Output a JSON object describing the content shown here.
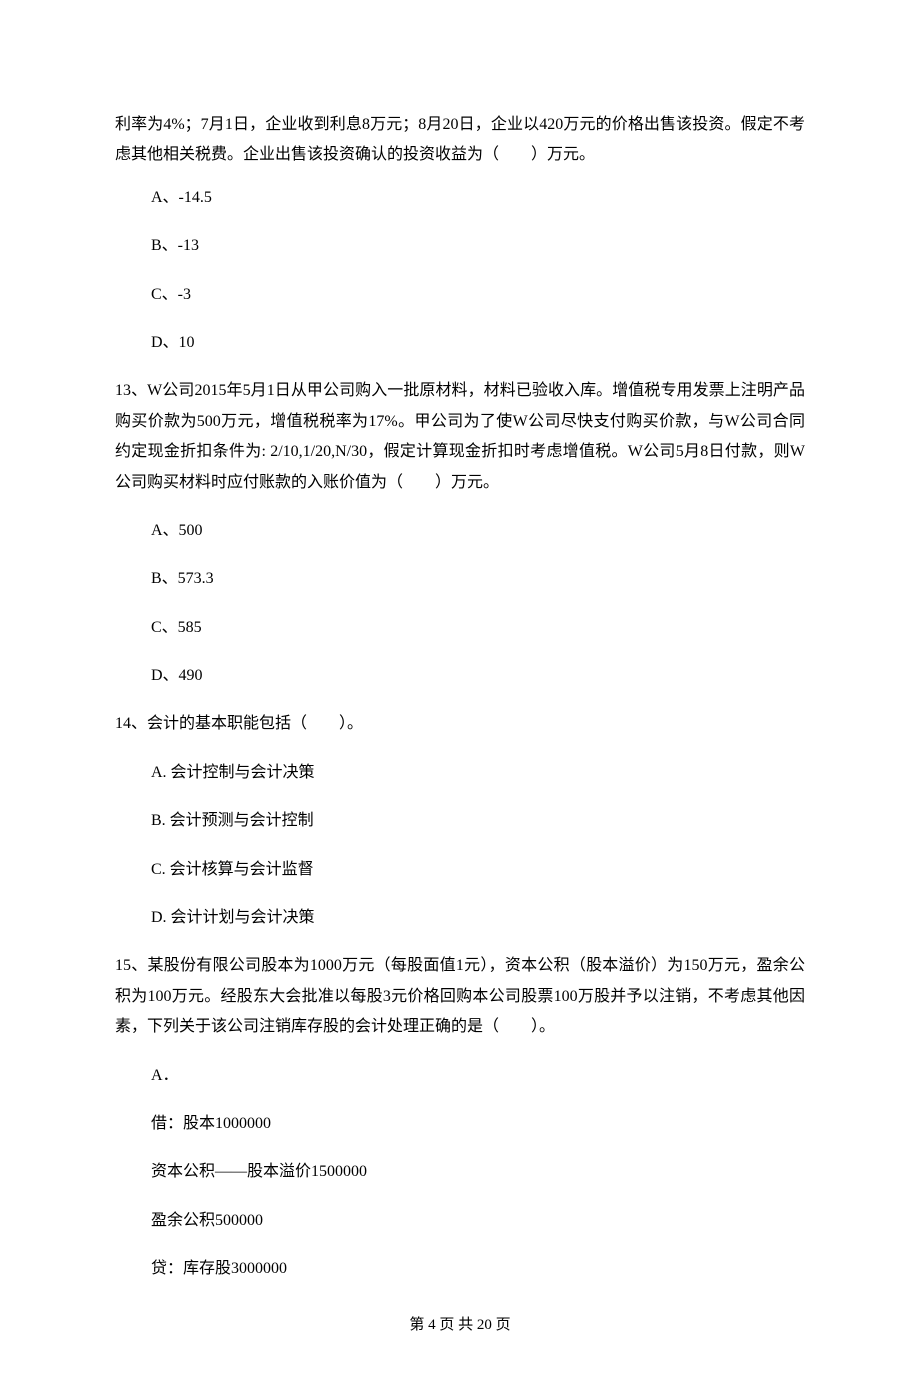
{
  "intro": "利率为4%；7月1日，企业收到利息8万元；8月20日，企业以420万元的价格出售该投资。假定不考虑其他相关税费。企业出售该投资确认的投资收益为（　　）万元。",
  "q12_options": {
    "a": "A、-14.5",
    "b": "B、-13",
    "c": "C、-3",
    "d": "D、10"
  },
  "q13": "13、W公司2015年5月1日从甲公司购入一批原材料，材料已验收入库。增值税专用发票上注明产品购买价款为500万元，增值税税率为17%。甲公司为了使W公司尽快支付购买价款，与W公司合同约定现金折扣条件为: 2/10,1/20,N/30，假定计算现金折扣时考虑增值税。W公司5月8日付款，则W公司购买材料时应付账款的入账价值为（　　）万元。",
  "q13_options": {
    "a": "A、500",
    "b": "B、573.3",
    "c": "C、585",
    "d": "D、490"
  },
  "q14": "14、会计的基本职能包括（　　）。",
  "q14_options": {
    "a": "A. 会计控制与会计决策",
    "b": "B. 会计预测与会计控制",
    "c": "C. 会计核算与会计监督",
    "d": "D. 会计计划与会计决策"
  },
  "q15": "15、某股份有限公司股本为1000万元（每股面值1元），资本公积（股本溢价）为150万元，盈余公积为100万元。经股东大会批准以每股3元价格回购本公司股票100万股并予以注销，不考虑其他因素，下列关于该公司注销库存股的会计处理正确的是（　　）。",
  "q15a": {
    "label": "A．",
    "line1": "借：股本1000000",
    "line2": "资本公积——股本溢价1500000",
    "line3": "盈余公积500000",
    "line4": "贷：库存股3000000"
  },
  "footer": "第 4 页 共 20 页"
}
